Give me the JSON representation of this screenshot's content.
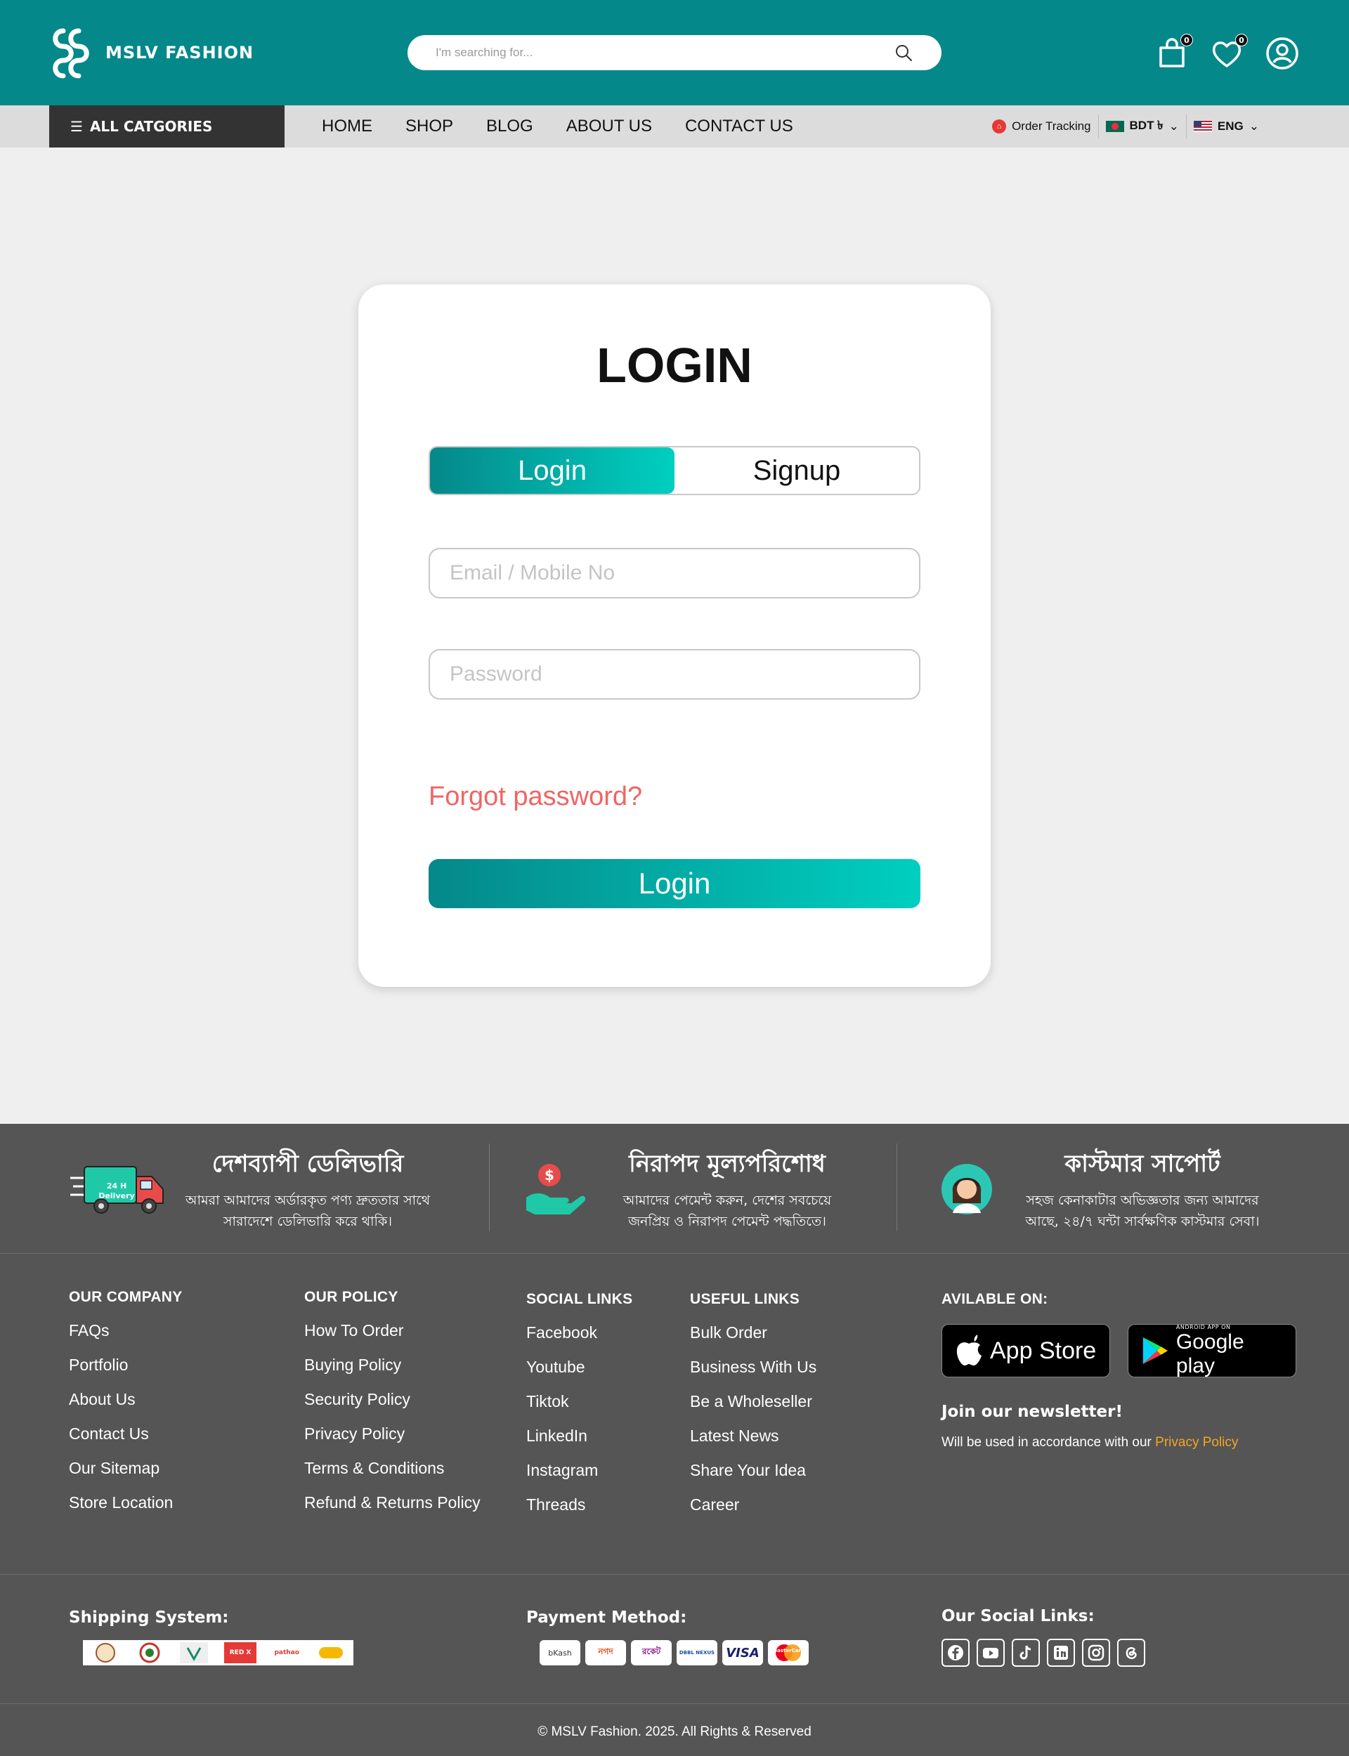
{
  "header": {
    "brand": "MSLV FASHION",
    "search_placeholder": "I'm searching for...",
    "cart_count": "0",
    "wishlist_count": "0"
  },
  "nav": {
    "all_categories": "ALL CATGORIES",
    "links": [
      "HOME",
      "SHOP",
      "BLOG",
      "ABOUT US",
      "CONTACT US"
    ],
    "order_tracking": "Order Tracking",
    "currency": "BDT ৳",
    "language": "ENG"
  },
  "login": {
    "title": "LOGIN",
    "tab_login": "Login",
    "tab_signup": "Signup",
    "email_placeholder": "Email / Mobile No",
    "password_placeholder": "Password",
    "forgot": "Forgot password?",
    "submit": "Login"
  },
  "features": [
    {
      "title": "দেশব্যাপী ডেলিভারি",
      "line1": "আমরা আমাদের অর্ডারকৃত পণ্য দ্রুততার সাথে",
      "line2": "সারাদেশে ডেলিভারি করে থাকি।",
      "truck_label": "24 H Delivery"
    },
    {
      "title": "নিরাপদ মূল্যপরিশোধ",
      "line1": "আমাদের পেমেন্ট করুন, দেশের সবচেয়ে",
      "line2": "জনপ্রিয় ও নিরাপদ পেমেন্ট পদ্ধতিতে।"
    },
    {
      "title": "কাস্টমার সাপোর্ট",
      "line1": "সহজ কেনাকাটার অভিজ্ঞতার জন্য আমাদের",
      "line2": "আছে, ২৪/৭ ঘন্টা সার্বক্ষণিক কাস্টমার সেবা।"
    }
  ],
  "footer": {
    "company": {
      "title": "OUR COMPANY",
      "items": [
        "FAQs",
        "Portfolio",
        "About Us",
        "Contact Us",
        "Our Sitemap",
        "Store Location"
      ]
    },
    "policy": {
      "title": "OUR POLICY",
      "items": [
        "How To Order",
        "Buying Policy",
        "Security Policy",
        "Privacy Policy",
        "Terms & Conditions",
        "Refund & Returns Policy"
      ]
    },
    "social": {
      "title": "SOCIAL LINKS",
      "items": [
        "Facebook",
        "Youtube",
        "Tiktok",
        "LinkedIn",
        "Instagram",
        "Threads"
      ]
    },
    "useful": {
      "title": "USEFUL LINKS",
      "items": [
        "Bulk Order",
        "Business With Us",
        "Be a Wholeseller",
        "Latest News",
        "Share Your Idea",
        "Career"
      ]
    },
    "available_on": "AVILABLE ON:",
    "app_store": "App Store",
    "google_play_small": "ANDROID APP ON",
    "google_play": "Google play",
    "newsletter_title": "Join our newsletter!",
    "newsletter_desc": "Will be used in accordance with our ",
    "privacy_link": "Privacy Policy",
    "shipping_title": "Shipping System:",
    "shipping_logos": [
      "",
      "",
      "",
      "RED X",
      "pathao",
      ""
    ],
    "payment_title": "Payment Method:",
    "payment_logos": [
      "bKash",
      "নগদ",
      "রকেট",
      "DBBL NEXUS",
      "VISA",
      "MasterCard"
    ],
    "social_title": "Our Social Links:",
    "copyright": "© MSLV Fashion. 2025. All Rights & Reserved"
  },
  "colors": {
    "primary": "#05888a",
    "accent_gradient_end": "#00cfc0",
    "footer": "#555555",
    "forgot": "#f06563",
    "privacy": "#f5a623"
  }
}
